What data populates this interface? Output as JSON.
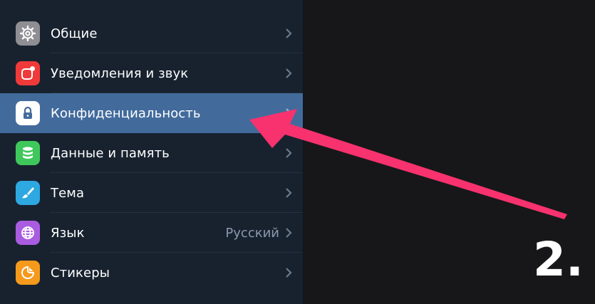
{
  "settings": {
    "items": [
      {
        "label": "Общие",
        "icon": "gear-icon",
        "icon_color": "#8e8e93"
      },
      {
        "label": "Уведомления и звук",
        "icon": "notification-icon",
        "icon_color": "#f03a3a"
      },
      {
        "label": "Конфиденциальность",
        "icon": "lock-icon",
        "icon_color": "#ffffff",
        "selected": true
      },
      {
        "label": "Данные и память",
        "icon": "database-icon",
        "icon_color": "#3fc75b"
      },
      {
        "label": "Тема",
        "icon": "brush-icon",
        "icon_color": "#2ea8e0"
      },
      {
        "label": "Язык",
        "icon": "globe-icon",
        "icon_color": "#a95ce0",
        "value": "Русский"
      },
      {
        "label": "Стикеры",
        "icon": "sticker-icon",
        "icon_color": "#f59a1c"
      }
    ]
  },
  "annotation": {
    "step_label": "2.",
    "arrow_color": "#f7326e",
    "selection_color": "#426b9c"
  }
}
